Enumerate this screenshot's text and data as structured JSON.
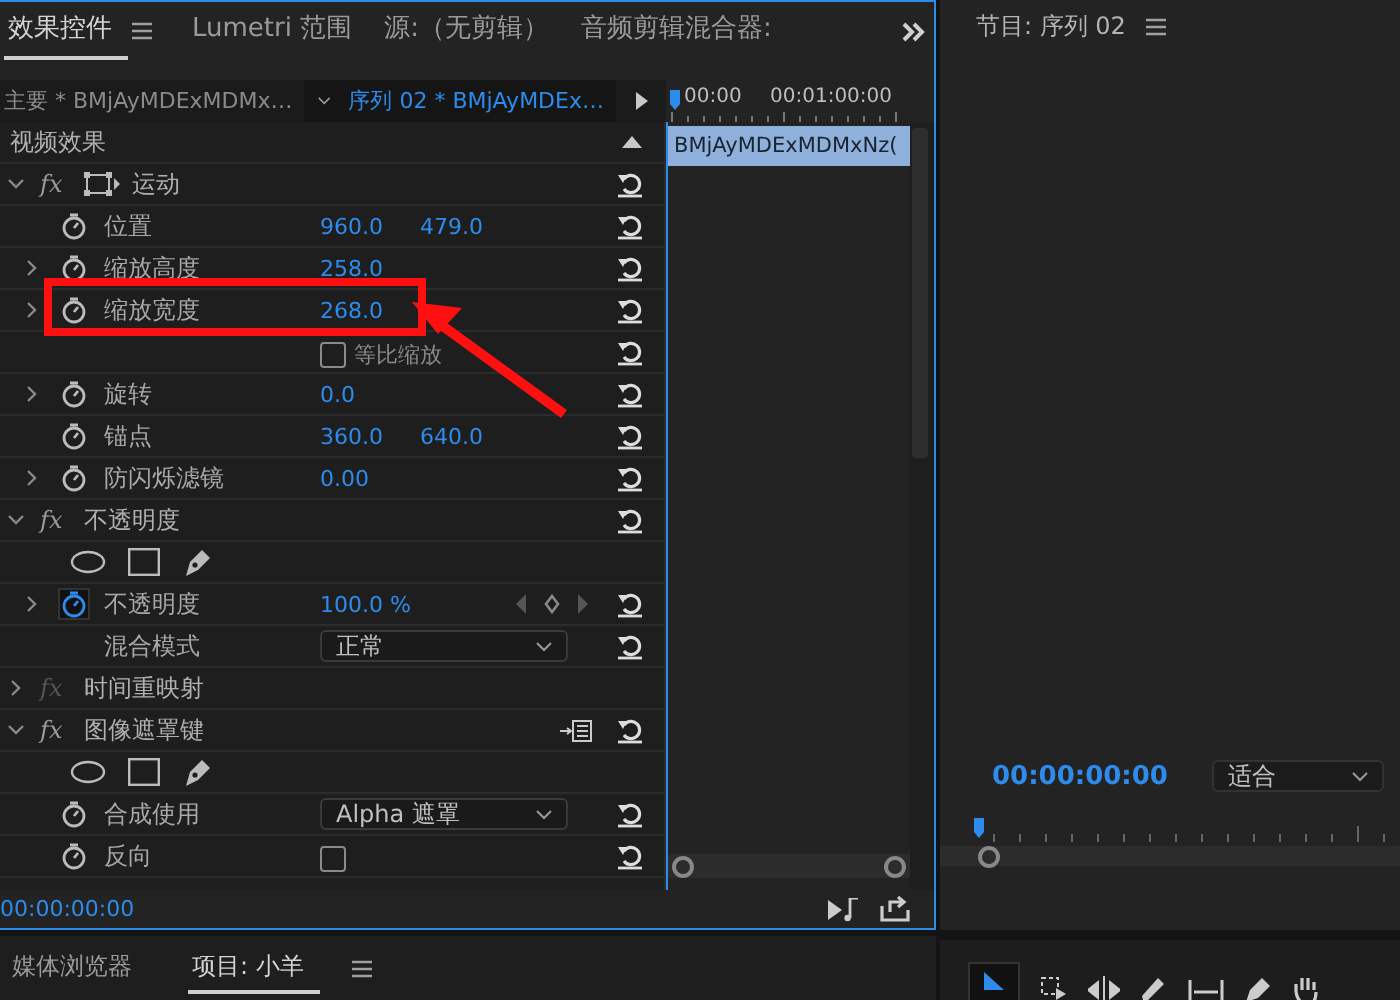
{
  "panel_tabs": [
    {
      "label": "效果控件",
      "selected": true,
      "menu": true
    },
    {
      "label": "Lumetri 范围",
      "selected": false,
      "menu": false
    },
    {
      "label": "源:（无剪辑）",
      "selected": false,
      "menu": false
    },
    {
      "label": "音频剪辑混合器:",
      "selected": false,
      "menu": false
    }
  ],
  "clip_bar": {
    "master": "主要 * BMjAyMDExMDMx…",
    "sequence": "序列 02 * BMjAyMDEx…"
  },
  "timeline": {
    "ruler": [
      "00:00",
      "00:01:00:00"
    ],
    "clip": "BMjAyMDExMDMxNz("
  },
  "rows": [
    {
      "kind": "category",
      "label": "视频效果",
      "expanded": true
    },
    {
      "kind": "effect",
      "badge": "fx",
      "label": "运动",
      "expanded": true,
      "enabled": true,
      "transform_icon": true,
      "reset": true
    },
    {
      "kind": "property",
      "label": "位置",
      "expandable": false,
      "animated": false,
      "values": [
        "960.0",
        "479.0"
      ],
      "keyframes": false,
      "reset": true
    },
    {
      "kind": "property",
      "label": "缩放高度",
      "expandable": true,
      "animated": false,
      "values": [
        "258.0"
      ],
      "keyframes": false,
      "reset": true
    },
    {
      "kind": "property",
      "label": "缩放宽度",
      "expandable": true,
      "animated": false,
      "values": [
        "268.0"
      ],
      "keyframes": false,
      "reset": true
    },
    {
      "kind": "checkbox",
      "label": "等比缩放",
      "checked": false,
      "reset": true
    },
    {
      "kind": "property",
      "label": "旋转",
      "expandable": true,
      "animated": false,
      "values": [
        "0.0"
      ],
      "keyframes": false,
      "reset": true
    },
    {
      "kind": "property",
      "label": "锚点",
      "expandable": false,
      "animated": false,
      "values": [
        "360.0",
        "640.0"
      ],
      "keyframes": false,
      "reset": true
    },
    {
      "kind": "property",
      "label": "防闪烁滤镜",
      "expandable": true,
      "animated": false,
      "values": [
        "0.00"
      ],
      "keyframes": false,
      "reset": true
    },
    {
      "kind": "effect",
      "badge": "fx",
      "label": "不透明度",
      "expanded": true,
      "enabled": true,
      "transform_icon": false,
      "reset": true
    },
    {
      "kind": "mask_tools"
    },
    {
      "kind": "property",
      "label": "不透明度",
      "expandable": true,
      "animated": true,
      "values": [
        "100.0 %"
      ],
      "keyframes": true,
      "reset": true
    },
    {
      "kind": "dropdown",
      "label": "混合模式",
      "value": "正常",
      "stopwatch": false,
      "reset": true
    },
    {
      "kind": "effect",
      "badge": "fx",
      "label": "时间重映射",
      "expanded": false,
      "enabled": false,
      "transform_icon": false,
      "reset": false
    },
    {
      "kind": "effect",
      "badge": "fx",
      "label": "图像遮罩键",
      "expanded": true,
      "enabled": true,
      "transform_icon": false,
      "filter_icon": true,
      "reset": true
    },
    {
      "kind": "mask_tools"
    },
    {
      "kind": "dropdown",
      "label": "合成使用",
      "value": "Alpha 遮罩",
      "stopwatch": true,
      "reset": true
    },
    {
      "kind": "toggle",
      "label": "反向",
      "checked": false,
      "reset": true
    }
  ],
  "timecode": "00:00:00:00",
  "lower_tabs": [
    {
      "label": "媒体浏览器",
      "selected": false,
      "menu": false
    },
    {
      "label": "项目: 小羊",
      "selected": true,
      "menu": true
    }
  ],
  "program": {
    "title": "节目: 序列 02",
    "timecode": "00:00:00:00",
    "zoom": "适合"
  }
}
